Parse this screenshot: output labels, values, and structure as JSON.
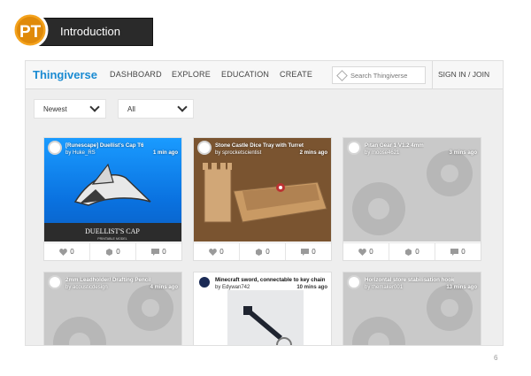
{
  "slide": {
    "title": "Introduction",
    "page_number": "6",
    "logo_text": "PT"
  },
  "site": {
    "brand": "Thingiverse",
    "nav": [
      "DASHBOARD",
      "EXPLORE",
      "EDUCATION",
      "CREATE"
    ],
    "search_placeholder": "Search Thingiverse",
    "sign_in": "SIGN IN / JOIN",
    "brand_color": "#1a8bd2"
  },
  "filters": {
    "sort": "Newest",
    "category": "All"
  },
  "cards": [
    {
      "title": "[Runescape] Duellist's Cap T6",
      "author": "by Huke_RS",
      "time": "1 min ago",
      "likes": "0",
      "collects": "0",
      "comments": "0",
      "image_caption": "DUELLIST'S CAP",
      "image_subcaption": "PRINTABLE MODEL"
    },
    {
      "title": "Stone Castle Dice Tray with Turret",
      "author": "by sprocketscientist",
      "time": "2 mins ago",
      "likes": "0",
      "collects": "0",
      "comments": "0"
    },
    {
      "title": "Pitan Gear 1 V1.2 4mm",
      "author": "by moose4621",
      "time": "3 mins ago",
      "likes": "0",
      "collects": "0",
      "comments": "0"
    },
    {
      "title": "2mm Leadholder/ Drafting Pencil",
      "author": "by acousticdesign",
      "time": "4 mins ago"
    },
    {
      "title": "Minecraft sword, connectable to key chain",
      "author": "by Edywan742",
      "time": "10 mins ago"
    },
    {
      "title": "Horizontal store stabilisation hook",
      "author": "by themaker001",
      "time": "13 mins ago"
    }
  ]
}
